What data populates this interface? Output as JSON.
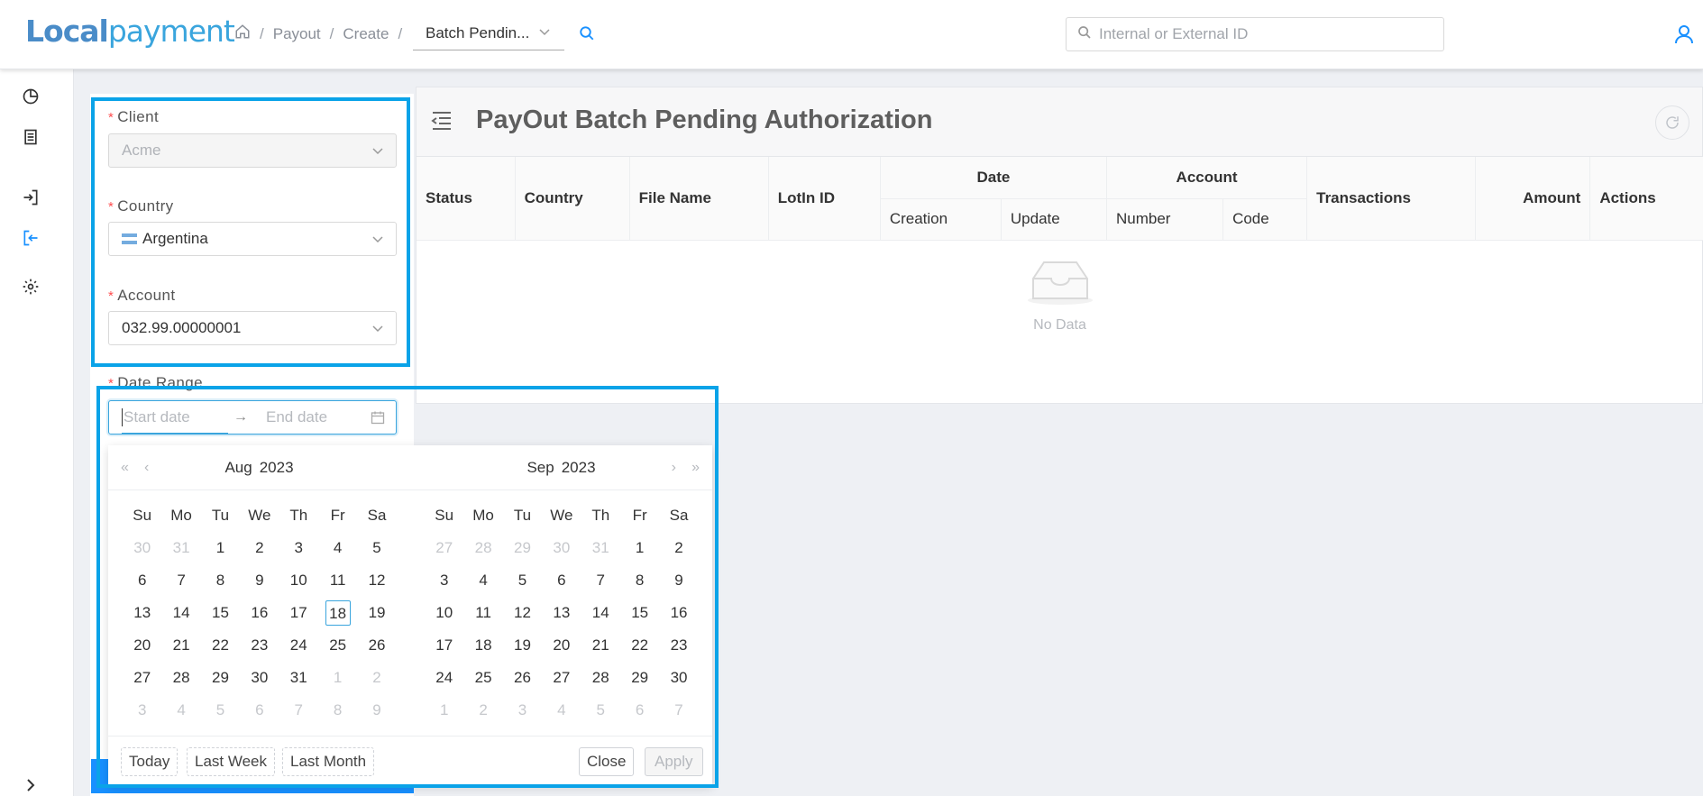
{
  "header": {
    "logo_part1": "Local",
    "logo_part2": "payment",
    "breadcrumb": [
      "Payout",
      "Create"
    ],
    "crumb_select": "Batch Pendin...",
    "search_placeholder": "Internal or External ID"
  },
  "sidebar": {
    "items": [
      "dashboard-icon",
      "document-icon",
      "login-icon",
      "logout-icon",
      "gear-icon"
    ]
  },
  "filters": {
    "client_label": "Client",
    "client_value": "Acme",
    "country_label": "Country",
    "country_value": "Argentina",
    "account_label": "Account",
    "account_value": "032.99.00000001",
    "date_label": "Date Range",
    "start_placeholder": "Start date",
    "end_placeholder": "End date",
    "required_mark": "*"
  },
  "calendar": {
    "left": {
      "month": "Aug",
      "year": "2023",
      "days": [
        [
          "30",
          "31",
          "1",
          "2",
          "3",
          "4",
          "5"
        ],
        [
          "6",
          "7",
          "8",
          "9",
          "10",
          "11",
          "12"
        ],
        [
          "13",
          "14",
          "15",
          "16",
          "17",
          "18",
          "19"
        ],
        [
          "20",
          "21",
          "22",
          "23",
          "24",
          "25",
          "26"
        ],
        [
          "27",
          "28",
          "29",
          "30",
          "31",
          "1",
          "2"
        ],
        [
          "3",
          "4",
          "5",
          "6",
          "7",
          "8",
          "9"
        ]
      ]
    },
    "right": {
      "month": "Sep",
      "year": "2023",
      "days": [
        [
          "27",
          "28",
          "29",
          "30",
          "31",
          "1",
          "2"
        ],
        [
          "3",
          "4",
          "5",
          "6",
          "7",
          "8",
          "9"
        ],
        [
          "10",
          "11",
          "12",
          "13",
          "14",
          "15",
          "16"
        ],
        [
          "17",
          "18",
          "19",
          "20",
          "21",
          "22",
          "23"
        ],
        [
          "24",
          "25",
          "26",
          "27",
          "28",
          "29",
          "30"
        ],
        [
          "1",
          "2",
          "3",
          "4",
          "5",
          "6",
          "7"
        ]
      ]
    },
    "weekdays": [
      "Su",
      "Mo",
      "Tu",
      "We",
      "Th",
      "Fr",
      "Sa"
    ],
    "today": "18",
    "presets": [
      "Today",
      "Last Week",
      "Last Month"
    ],
    "close_label": "Close",
    "apply_label": "Apply"
  },
  "main": {
    "title": "PayOut Batch Pending Authorization",
    "columns": {
      "status": "Status",
      "country": "Country",
      "file_name": "File Name",
      "lotin": "LotIn ID",
      "date": "Date",
      "creation": "Creation",
      "update": "Update",
      "account": "Account",
      "number": "Number",
      "code": "Code",
      "transactions": "Transactions",
      "amount": "Amount",
      "actions": "Actions"
    },
    "empty_text": "No Data"
  },
  "colors": {
    "accent": "#3aa5dd",
    "highlight": "#0aa3e8",
    "required": "#ff4d4f"
  }
}
